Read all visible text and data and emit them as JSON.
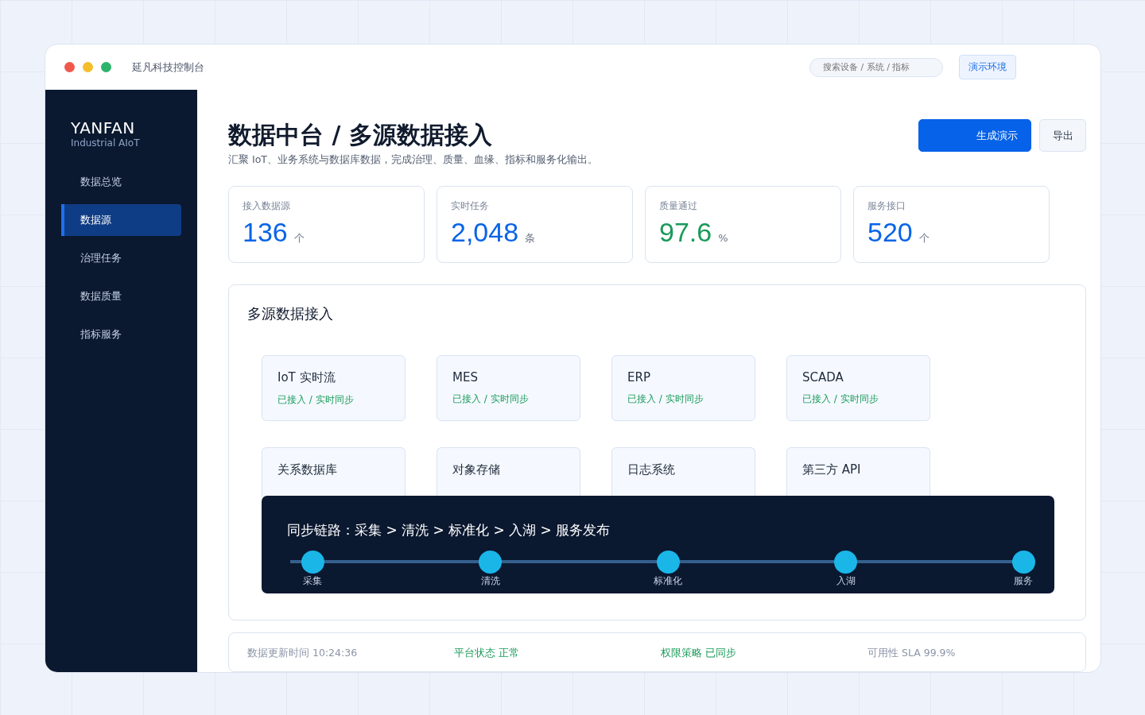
{
  "window": {
    "title": "延凡科技控制台",
    "search": {
      "placeholder": "搜索设备 / 系统 / 指标"
    },
    "env_badge": "演示环境"
  },
  "sidebar": {
    "brand": "YANFAN",
    "tagline": "Industrial AIoT",
    "items": [
      {
        "label": "数据总览",
        "selected": false
      },
      {
        "label": "数据源",
        "selected": true
      },
      {
        "label": "治理任务",
        "selected": false
      },
      {
        "label": "数据质量",
        "selected": false
      },
      {
        "label": "指标服务",
        "selected": false
      }
    ]
  },
  "header": {
    "title": "数据中台 / 多源数据接入",
    "subtitle": "汇聚 IoT、业务系统与数据库数据，完成治理、质量、血缘、指标和服务化输出。",
    "buttons": [
      {
        "label": "生成演示",
        "kind": "primary"
      },
      {
        "label": "导出",
        "kind": "secondary"
      }
    ]
  },
  "stats": [
    {
      "label": "接入数据源",
      "value": "136",
      "unit": "个",
      "color": "#0a64e6"
    },
    {
      "label": "实时任务",
      "value": "2,048",
      "unit": "条",
      "color": "#0a64e6"
    },
    {
      "label": "质量通过",
      "value": "97.6",
      "unit": "%",
      "color": "#1a9a5a"
    },
    {
      "label": "服务接口",
      "value": "520",
      "unit": "个",
      "color": "#0a64e6"
    }
  ],
  "panel": {
    "title": "多源数据接入",
    "sources": [
      {
        "name": "IoT 实时流",
        "status": "已接入 / 实时同步"
      },
      {
        "name": "MES",
        "status": "已接入 / 实时同步"
      },
      {
        "name": "ERP",
        "status": "已接入 / 实时同步"
      },
      {
        "name": "SCADA",
        "status": "已接入 / 实时同步"
      },
      {
        "name": "关系数据库"
      },
      {
        "name": "对象存储"
      },
      {
        "name": "日志系统"
      },
      {
        "name": "第三方 API"
      }
    ],
    "pipeline": {
      "title": "同步链路：采集 > 清洗 > 标准化 > 入湖 > 服务发布",
      "steps": [
        "采集",
        "清洗",
        "标准化",
        "入湖",
        "服务"
      ]
    }
  },
  "status_bar": [
    {
      "text": "数据更新时间 10:24:36",
      "kind": "info"
    },
    {
      "text": "平台状态 正常",
      "kind": "ok"
    },
    {
      "text": "权限策略 已同步",
      "kind": "ok"
    },
    {
      "text": "可用性 SLA 99.9%",
      "kind": "info"
    }
  ]
}
